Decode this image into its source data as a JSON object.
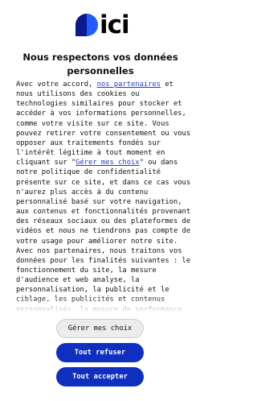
{
  "brand": {
    "name": "ici",
    "colors": {
      "primary": "#0e2fbf",
      "accent_blue": "#1f5bff"
    }
  },
  "dialog": {
    "title": "Nous respectons vos données personnelles",
    "body": {
      "p1": "Avec votre accord, ",
      "link_partners": "nos partenaires",
      "p2": " et nous utilisons des cookies ou technologies similaires pour stocker et accéder à vos informations personnelles, comme votre visite sur ce site. Vous pouvez retirer votre consentement ou vous opposer aux traitements fondés sur l'intérêt légitime à tout moment en cliquant sur \"",
      "link_manage": "Gérer mes choix",
      "p3": "\" ou dans notre politique de confidentialité présente sur ce site, et dans ce cas vous n'aurez plus accès à du contenu personnalisé basé sur votre navigation, aux contenus et fonctionnalités provenant des réseaux sociaux ou des plateformes de vidéos et nous ne tiendrons pas compte de votre usage pour améliorer notre site. Avec nos partenaires, nous traitons vos données pour les finalités suivantes : le fonctionnement du site, la mesure d'audience et web analyse, la personnalisation, la publicité et le ciblage, les publicités et contenus personnalisés, la mesure de performance"
    },
    "buttons": {
      "manage": "Gérer mes choix",
      "refuse": "Tout refuser",
      "accept": "Tout accepter"
    }
  }
}
